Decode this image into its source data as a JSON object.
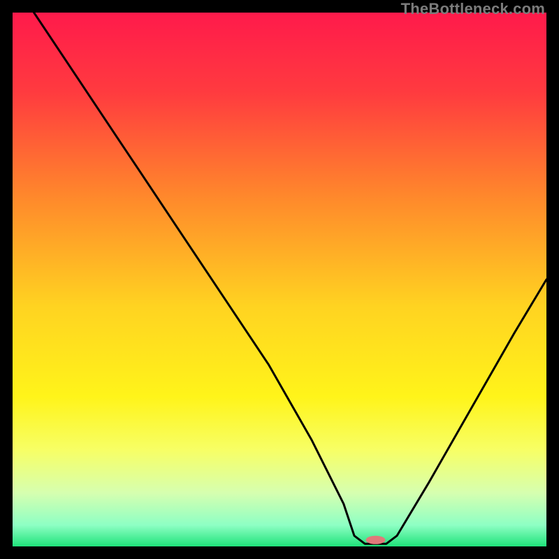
{
  "watermark": "TheBottleneck.com",
  "chart_data": {
    "type": "line",
    "title": "",
    "xlabel": "",
    "ylabel": "",
    "xlim": [
      0,
      100
    ],
    "ylim": [
      0,
      100
    ],
    "grid": false,
    "legend": false,
    "gradient_stops": [
      {
        "pos": 0.0,
        "color": "#ff1a4b"
      },
      {
        "pos": 0.15,
        "color": "#ff3b3f"
      },
      {
        "pos": 0.35,
        "color": "#ff8a2b"
      },
      {
        "pos": 0.55,
        "color": "#ffd321"
      },
      {
        "pos": 0.72,
        "color": "#fff41a"
      },
      {
        "pos": 0.82,
        "color": "#f7ff66"
      },
      {
        "pos": 0.9,
        "color": "#d6ffb0"
      },
      {
        "pos": 0.96,
        "color": "#8effc4"
      },
      {
        "pos": 1.0,
        "color": "#1fe37a"
      }
    ],
    "curve": [
      {
        "x": 4,
        "y": 100
      },
      {
        "x": 12,
        "y": 88
      },
      {
        "x": 20,
        "y": 76
      },
      {
        "x": 24,
        "y": 70
      },
      {
        "x": 32,
        "y": 58
      },
      {
        "x": 40,
        "y": 46
      },
      {
        "x": 48,
        "y": 34
      },
      {
        "x": 56,
        "y": 20
      },
      {
        "x": 62,
        "y": 8
      },
      {
        "x": 64,
        "y": 2
      },
      {
        "x": 66,
        "y": 0.5
      },
      {
        "x": 70,
        "y": 0.5
      },
      {
        "x": 72,
        "y": 2
      },
      {
        "x": 78,
        "y": 12
      },
      {
        "x": 86,
        "y": 26
      },
      {
        "x": 94,
        "y": 40
      },
      {
        "x": 100,
        "y": 50
      }
    ],
    "marker": {
      "x": 68,
      "y": 1.2,
      "color": "#e07a7a",
      "rx": 14,
      "ry": 6
    }
  }
}
